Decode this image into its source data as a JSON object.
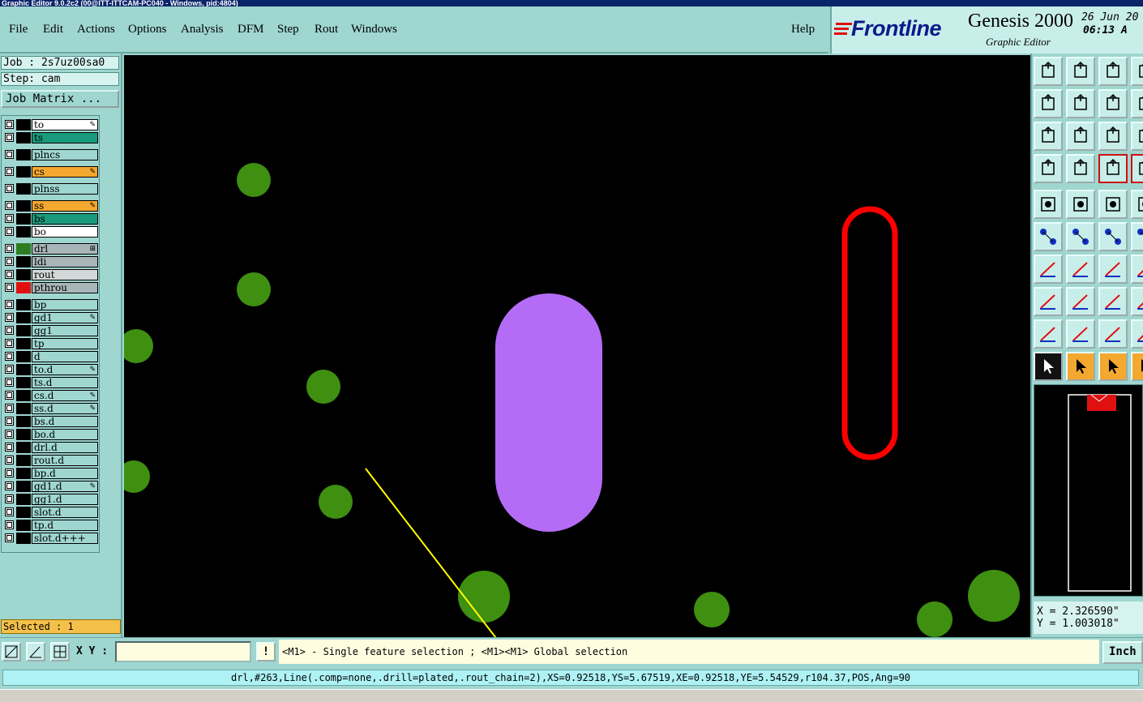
{
  "window": {
    "title": "Graphic Editor 9.0.2c2 (00@ITT-ITTCAM-PC040 - Windows, pid:4804)"
  },
  "menu": {
    "items": [
      "File",
      "Edit",
      "Actions",
      "Options",
      "Analysis",
      "DFM",
      "Step",
      "Rout",
      "Windows"
    ],
    "help": "Help"
  },
  "brand": {
    "logo": "Frontline",
    "product": "Genesis 2000",
    "subtitle": "Graphic Editor",
    "date": "26 Jun 20",
    "time": "06:13 A"
  },
  "job": {
    "job_line": "Job : 2s7uz00sa0",
    "step_line": "Step: cam",
    "matrix_button": "Job Matrix ...",
    "selected": "Selected : 1"
  },
  "layers": [
    {
      "name": "to",
      "color": "#ffffff",
      "swatch": "#000000",
      "mark": "✎"
    },
    {
      "name": "ts",
      "color": "#1a9a7c",
      "swatch": "#000000",
      "mark": ""
    },
    {
      "name": "plncs",
      "color": "#9fd6d0",
      "swatch": "#000000",
      "mark": ""
    },
    {
      "name": "cs",
      "color": "#f4a830",
      "swatch": "#000000",
      "mark": "✎"
    },
    {
      "name": "plnss",
      "color": "#9fd6d0",
      "swatch": "#000000",
      "mark": ""
    },
    {
      "name": "ss",
      "color": "#f4a830",
      "swatch": "#000000",
      "mark": "✎"
    },
    {
      "name": "bs",
      "color": "#1a9a7c",
      "swatch": "#000000",
      "mark": ""
    },
    {
      "name": "bo",
      "color": "#ffffff",
      "swatch": "#000000",
      "mark": ""
    },
    {
      "name": "drl",
      "color": "#a9b6b9",
      "swatch": "#2e7d20",
      "mark": "⊞"
    },
    {
      "name": "ldi",
      "color": "#a9b6b9",
      "swatch": "#000000",
      "mark": ""
    },
    {
      "name": "rout",
      "color": "#d3d8d8",
      "swatch": "#000000",
      "mark": ""
    },
    {
      "name": "pthrou",
      "color": "#a9b6b9",
      "swatch": "#e01010",
      "mark": ""
    },
    {
      "name": "bp",
      "color": "#9fd6d0",
      "swatch": "#000000",
      "mark": ""
    },
    {
      "name": "gd1",
      "color": "#9fd6d0",
      "swatch": "#000000",
      "mark": "✎"
    },
    {
      "name": "gg1",
      "color": "#9fd6d0",
      "swatch": "#000000",
      "mark": ""
    },
    {
      "name": "tp",
      "color": "#9fd6d0",
      "swatch": "#000000",
      "mark": ""
    },
    {
      "name": "d",
      "color": "#9fd6d0",
      "swatch": "#000000",
      "mark": ""
    },
    {
      "name": "to.d",
      "color": "#9fd6d0",
      "swatch": "#000000",
      "mark": "✎"
    },
    {
      "name": "ts.d",
      "color": "#9fd6d0",
      "swatch": "#000000",
      "mark": ""
    },
    {
      "name": "cs.d",
      "color": "#9fd6d0",
      "swatch": "#000000",
      "mark": "✎"
    },
    {
      "name": "ss.d",
      "color": "#9fd6d0",
      "swatch": "#000000",
      "mark": "✎"
    },
    {
      "name": "bs.d",
      "color": "#9fd6d0",
      "swatch": "#000000",
      "mark": ""
    },
    {
      "name": "bo.d",
      "color": "#9fd6d0",
      "swatch": "#000000",
      "mark": ""
    },
    {
      "name": "drl.d",
      "color": "#9fd6d0",
      "swatch": "#000000",
      "mark": ""
    },
    {
      "name": "rout.d",
      "color": "#9fd6d0",
      "swatch": "#000000",
      "mark": ""
    },
    {
      "name": "bp.d",
      "color": "#9fd6d0",
      "swatch": "#000000",
      "mark": ""
    },
    {
      "name": "gd1.d",
      "color": "#9fd6d0",
      "swatch": "#000000",
      "mark": "✎"
    },
    {
      "name": "gg1.d",
      "color": "#9fd6d0",
      "swatch": "#000000",
      "mark": ""
    },
    {
      "name": "slot.d",
      "color": "#9fd6d0",
      "swatch": "#000000",
      "mark": ""
    },
    {
      "name": "tp.d",
      "color": "#9fd6d0",
      "swatch": "#000000",
      "mark": ""
    },
    {
      "name": "slot.d+++",
      "color": "#9fd6d0",
      "swatch": "#000000",
      "mark": ""
    }
  ],
  "coords": {
    "x": "X = 2.326590\"",
    "y": "Y = 1.003018\""
  },
  "input": {
    "xy_label": "X Y :",
    "xy_value": "",
    "warn": "!"
  },
  "message": "<M1> - Single feature selection ; <M1><M1> Global selection",
  "units": "Inch",
  "status": "drl,#263,Line(.comp=none,.drill=plated,.rout_chain=2),XS=0.92518,YS=5.67519,XE=0.92518,YE=5.54529,r104.37,POS,Ang=90",
  "colors": {
    "pad_green": "#3f8f10",
    "slot_purple": "#b46cf6",
    "rout_red": "#ff0000",
    "highlight_yellow": "#ffff00"
  }
}
